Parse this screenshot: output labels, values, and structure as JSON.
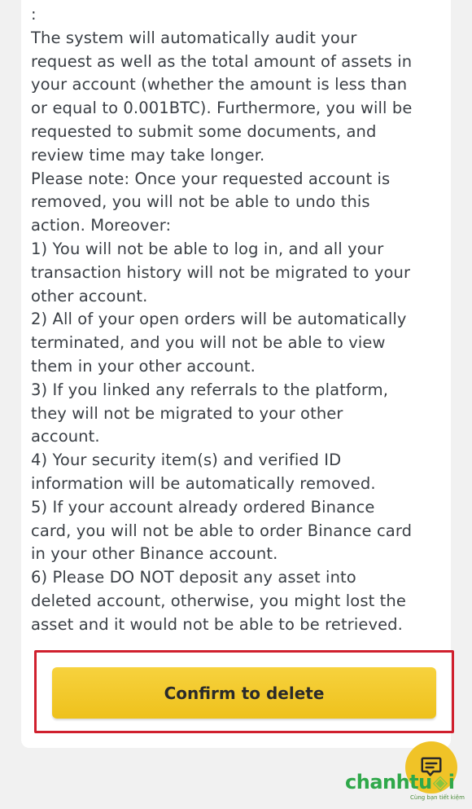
{
  "content": {
    "lines": [
      ":",
      "The system will automatically audit your",
      "request as well as the total amount of assets in",
      "your account (whether the amount is less than",
      "or equal to 0.001BTC). Furthermore, you will be",
      "requested to submit some documents, and",
      "review time may take longer.",
      "Please note: Once your requested account is",
      "removed, you will not be able to undo this",
      "action. Moreover:",
      "1) You will not be able to log in, and all your",
      "transaction history will not be migrated to your",
      "other account.",
      "2) All of your open orders will be automatically",
      "terminated, and you will not be able to view",
      "them in your other account.",
      "3) If you linked any referrals to the platform,",
      "they will not be migrated to your other",
      "account.",
      "4) Your security item(s) and verified ID",
      "information will be automatically removed.",
      "5) If your account already ordered Binance",
      "card, you will not be able to order Binance card",
      "in your other Binance account.",
      "6) Please DO NOT deposit any asset into",
      "deleted account, otherwise, you might lost the",
      "asset and it would not be able to be retrieved."
    ]
  },
  "actions": {
    "confirm_label": "Confirm to delete"
  },
  "fab": {
    "icon": "chat-icon"
  },
  "watermark": {
    "brand_start": "chanht",
    "brand_mid": "u",
    "brand_end": "i",
    "tagline": "Cùng bạn tiết kiệm"
  },
  "colors": {
    "accent": "#f0c327",
    "highlight_border": "#d0202e",
    "text": "#3a3f45",
    "watermark_green": "#2fa84a"
  }
}
